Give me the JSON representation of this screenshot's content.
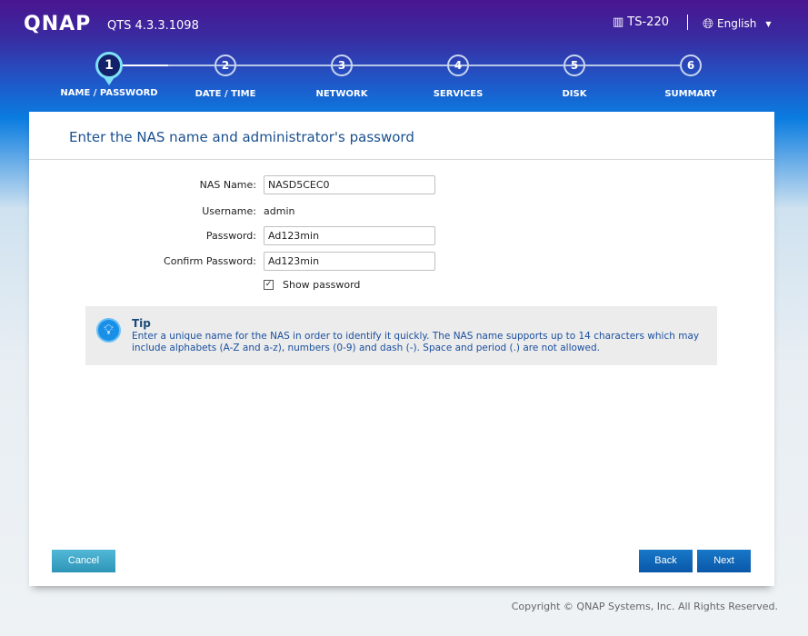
{
  "header": {
    "logo": "QNAP",
    "version": "QTS 4.3.3.1098",
    "model": "TS-220",
    "language": "English"
  },
  "steps": [
    {
      "num": "1",
      "label": "NAME / PASSWORD",
      "active": true
    },
    {
      "num": "2",
      "label": "DATE / TIME"
    },
    {
      "num": "3",
      "label": "NETWORK"
    },
    {
      "num": "4",
      "label": "SERVICES"
    },
    {
      "num": "5",
      "label": "DISK"
    },
    {
      "num": "6",
      "label": "SUMMARY"
    }
  ],
  "main": {
    "title": "Enter the NAS name and administrator's password",
    "nas_name": {
      "label": "NAS Name:",
      "value": "NASD5CEC0"
    },
    "username": {
      "label": "Username:",
      "value": "admin"
    },
    "password": {
      "label": "Password:",
      "value": "Ad123min"
    },
    "confirm": {
      "label": "Confirm Password:",
      "value": "Ad123min"
    },
    "show_password": {
      "label": "Show password",
      "checked": true
    },
    "tip": {
      "title": "Tip",
      "text": "Enter a unique name for the NAS in order to identify it quickly. The NAS name supports up to 14 characters which may include alphabets (A-Z and a-z), numbers (0-9) and dash (-). Space and period (.) are not allowed."
    }
  },
  "buttons": {
    "cancel": "Cancel",
    "back": "Back",
    "next": "Next"
  },
  "footer": {
    "copyright": "Copyright © QNAP Systems, Inc. All Rights Reserved."
  },
  "colors": {
    "accent": "#0a57a8",
    "cancel": "#3aa8c8",
    "header_top": "#4a1590",
    "header_bottom": "#0a7ce0"
  }
}
